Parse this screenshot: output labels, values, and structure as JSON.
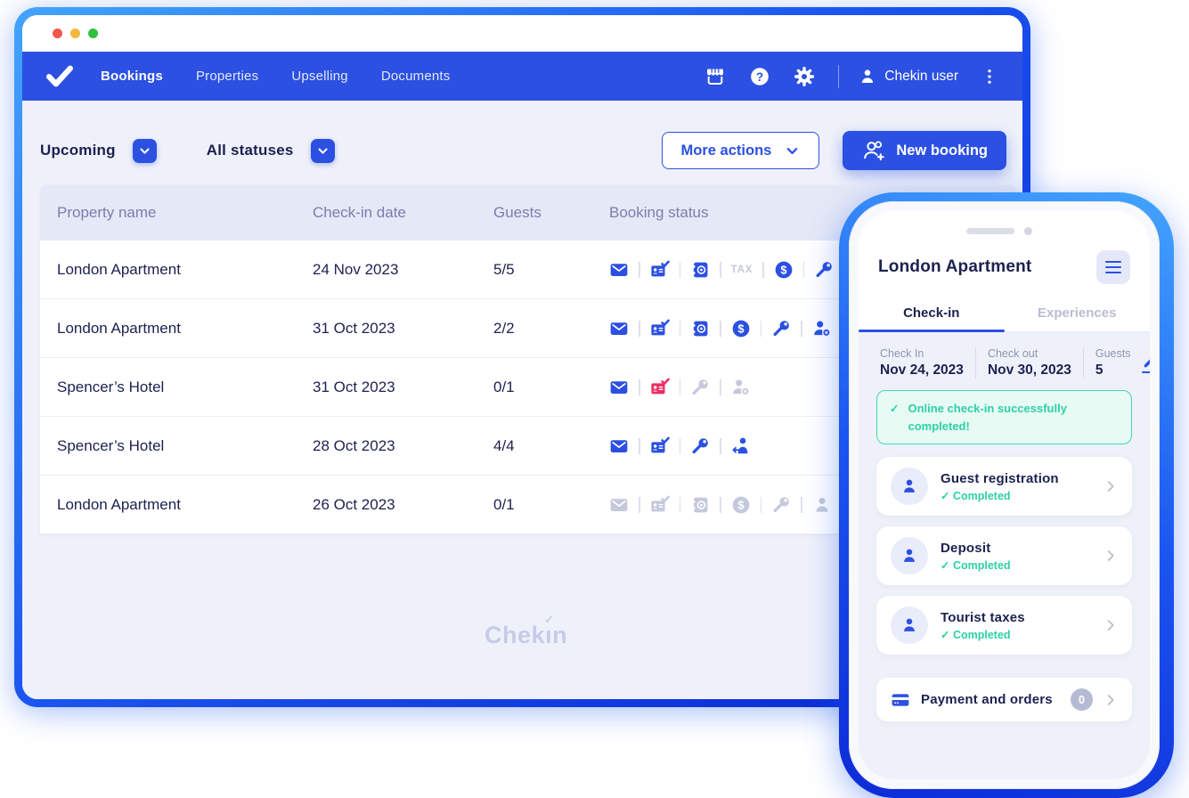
{
  "colors": {
    "primary": "#2b50e2",
    "danger": "#ee2e63",
    "success": "#2ed0a5",
    "disabled": "#c5c9db",
    "traffic": [
      "#f5564c",
      "#f3b840",
      "#2fc23f"
    ]
  },
  "navbar": {
    "items": [
      {
        "label": "Bookings",
        "active": true
      },
      {
        "label": "Properties",
        "active": false
      },
      {
        "label": "Upselling",
        "active": false
      },
      {
        "label": "Documents",
        "active": false
      }
    ],
    "icons": [
      "storefront",
      "help",
      "gear"
    ],
    "user_label": "Chekin user"
  },
  "filters": {
    "period": "Upcoming",
    "status": "All statuses"
  },
  "actions": {
    "more": "More actions",
    "new_booking": "New booking"
  },
  "table": {
    "columns": [
      "Property name",
      "Check-in date",
      "Guests",
      "Booking status"
    ],
    "rows": [
      {
        "property": "London Apartment",
        "checkin": "24 Nov 2023",
        "guests": "5/5",
        "status_icons": [
          {
            "icon": "envelope",
            "state": "active"
          },
          {
            "icon": "id-card-check",
            "state": "active"
          },
          {
            "icon": "register",
            "state": "active"
          },
          {
            "icon": "tax",
            "state": "disabled"
          },
          {
            "icon": "dollar",
            "state": "active"
          },
          {
            "icon": "key",
            "state": "active"
          }
        ]
      },
      {
        "property": "London Apartment",
        "checkin": "31 Oct 2023",
        "guests": "2/2",
        "status_icons": [
          {
            "icon": "envelope",
            "state": "active"
          },
          {
            "icon": "id-card-check",
            "state": "active"
          },
          {
            "icon": "register",
            "state": "active"
          },
          {
            "icon": "dollar",
            "state": "active"
          },
          {
            "icon": "key",
            "state": "active"
          },
          {
            "icon": "guest-stamp",
            "state": "active"
          }
        ]
      },
      {
        "property": "Spencer’s Hotel",
        "checkin": "31 Oct 2023",
        "guests": "0/1",
        "status_icons": [
          {
            "icon": "envelope",
            "state": "active"
          },
          {
            "icon": "id-card-check",
            "state": "error"
          },
          {
            "icon": "key",
            "state": "disabled"
          },
          {
            "icon": "guest-stamp",
            "state": "disabled"
          }
        ]
      },
      {
        "property": "Spencer’s Hotel",
        "checkin": "28 Oct 2023",
        "guests": "4/4",
        "status_icons": [
          {
            "icon": "envelope",
            "state": "active"
          },
          {
            "icon": "id-card-check",
            "state": "active"
          },
          {
            "icon": "key",
            "state": "active"
          },
          {
            "icon": "guest-checkout",
            "state": "active"
          }
        ]
      },
      {
        "property": "London Apartment",
        "checkin": "26 Oct 2023",
        "guests": "0/1",
        "status_icons": [
          {
            "icon": "envelope",
            "state": "disabled"
          },
          {
            "icon": "id-card-check",
            "state": "disabled"
          },
          {
            "icon": "register",
            "state": "disabled"
          },
          {
            "icon": "dollar",
            "state": "disabled"
          },
          {
            "icon": "key",
            "state": "disabled"
          },
          {
            "icon": "guest",
            "state": "disabled"
          }
        ]
      }
    ]
  },
  "watermark": "Chekin",
  "phone": {
    "title": "London Apartment",
    "tabs": [
      {
        "label": "Check-in",
        "active": true
      },
      {
        "label": "Experiences",
        "active": false
      }
    ],
    "info": [
      {
        "label": "Check In",
        "value": "Nov 24, 2023"
      },
      {
        "label": "Check out",
        "value": "Nov 30, 2023"
      },
      {
        "label": "Guests",
        "value": "5"
      }
    ],
    "alert": "Online check-in successfully completed!",
    "cards": [
      {
        "title": "Guest registration",
        "status": "Completed"
      },
      {
        "title": "Deposit",
        "status": "Completed"
      },
      {
        "title": "Tourist taxes",
        "status": "Completed"
      }
    ],
    "payment": {
      "title": "Payment and orders",
      "badge": "0"
    }
  }
}
